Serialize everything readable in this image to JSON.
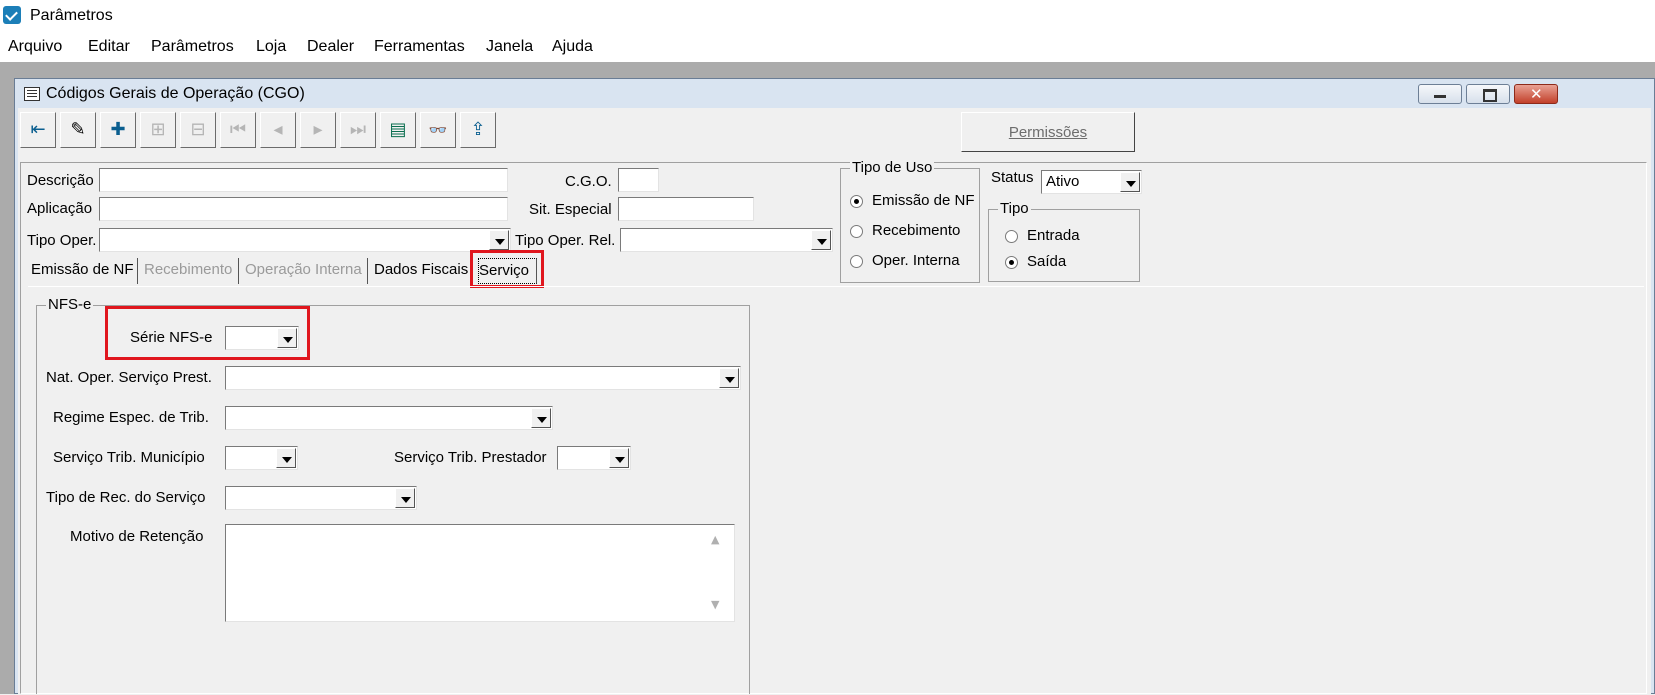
{
  "window": {
    "title": "Parâmetros"
  },
  "menu": [
    "Arquivo",
    "Editar",
    "Parâmetros",
    "Loja",
    "Dealer",
    "Ferramentas",
    "Janela",
    "Ajuda"
  ],
  "child_window": {
    "title": "Códigos Gerais de Operação (CGO)"
  },
  "toolbar": {
    "buttons": [
      {
        "icon": "exit-icon"
      },
      {
        "icon": "eraser-icon"
      },
      {
        "icon": "add-folder-icon"
      },
      {
        "icon": "add-disabled-icon"
      },
      {
        "icon": "remove-disabled-icon"
      },
      {
        "icon": "first-icon"
      },
      {
        "icon": "prev-icon"
      },
      {
        "icon": "next-icon"
      },
      {
        "icon": "last-icon"
      },
      {
        "icon": "ledger-icon"
      },
      {
        "icon": "binoculars-icon"
      },
      {
        "icon": "export-icon"
      }
    ],
    "permissions_label": "Permissões"
  },
  "form": {
    "descricao_label": "Descrição",
    "descricao_value": "",
    "aplicacao_label": "Aplicação",
    "aplicacao_value": "",
    "tipo_oper_label": "Tipo Oper.",
    "tipo_oper_value": "",
    "cgo_label": "C.G.O.",
    "cgo_value": "",
    "sit_especial_label": "Sit. Especial",
    "sit_especial_value": "",
    "tipo_oper_rel_label": "Tipo Oper. Rel.",
    "tipo_oper_rel_value": "",
    "tipo_uso": {
      "title": "Tipo de Uso",
      "options": [
        "Emissão de NF",
        "Recebimento",
        "Oper. Interna"
      ],
      "selected": "Emissão de NF"
    },
    "status_label": "Status",
    "status_value": "Ativo",
    "tipo": {
      "title": "Tipo",
      "options": [
        "Entrada",
        "Saída"
      ],
      "selected": "Saída"
    }
  },
  "tabs": [
    {
      "label": "Emissão de NF",
      "enabled": true
    },
    {
      "label": "Recebimento",
      "enabled": false
    },
    {
      "label": "Operação Interna",
      "enabled": false
    },
    {
      "label": "Dados Fiscais",
      "enabled": true
    },
    {
      "label": "Serviço",
      "enabled": true,
      "active": true
    }
  ],
  "servico": {
    "group_title": "NFS-e",
    "serie_nfse_label": "Série NFS-e",
    "serie_nfse_value": "",
    "nat_oper_label": "Nat. Oper. Serviço Prest.",
    "nat_oper_value": "",
    "regime_label": "Regime Espec. de Trib.",
    "regime_value": "",
    "serv_trib_mun_label": "Serviço Trib. Município",
    "serv_trib_mun_value": "",
    "serv_trib_prest_label": "Serviço Trib. Prestador",
    "serv_trib_prest_value": "",
    "tipo_rec_label": "Tipo de Rec. do Serviço",
    "tipo_rec_value": "",
    "motivo_label": "Motivo de Retenção",
    "motivo_value": ""
  },
  "colors": {
    "highlight": "#e0161e",
    "title_bar": "#d9e4f1"
  }
}
